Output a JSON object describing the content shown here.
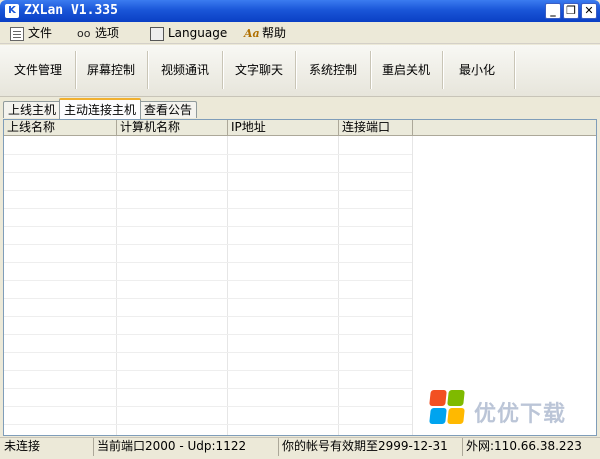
{
  "window": {
    "title": "ZXLan V1.335",
    "min": "_",
    "max": "❐",
    "close": "✕"
  },
  "menu": {
    "file": "文件",
    "options": "选项",
    "language": "Language",
    "help": "帮助"
  },
  "toolbar": {
    "file_manage": "文件管理",
    "screen_control": "屏幕控制",
    "video": "视频通讯",
    "chat": "文字聊天",
    "system_control": "系统控制",
    "restart": "重启关机",
    "minimize": "最小化"
  },
  "tabs": [
    "上线主机",
    "主动连接主机",
    "查看公告"
  ],
  "list": {
    "columns": [
      "上线名称",
      "计算机名称",
      "IP地址",
      "连接端口"
    ],
    "rows": []
  },
  "status": {
    "connection": "未连接",
    "port": "当前端口2000 - Udp:1122",
    "expiry": "你的帐号有效期至2999-12-31",
    "wan": "外网:110.66.38.223"
  },
  "watermark": {
    "text": "优优下载"
  },
  "colors": {
    "titlebar": "#0a3fc4",
    "accent_tab": "#f0b030"
  }
}
